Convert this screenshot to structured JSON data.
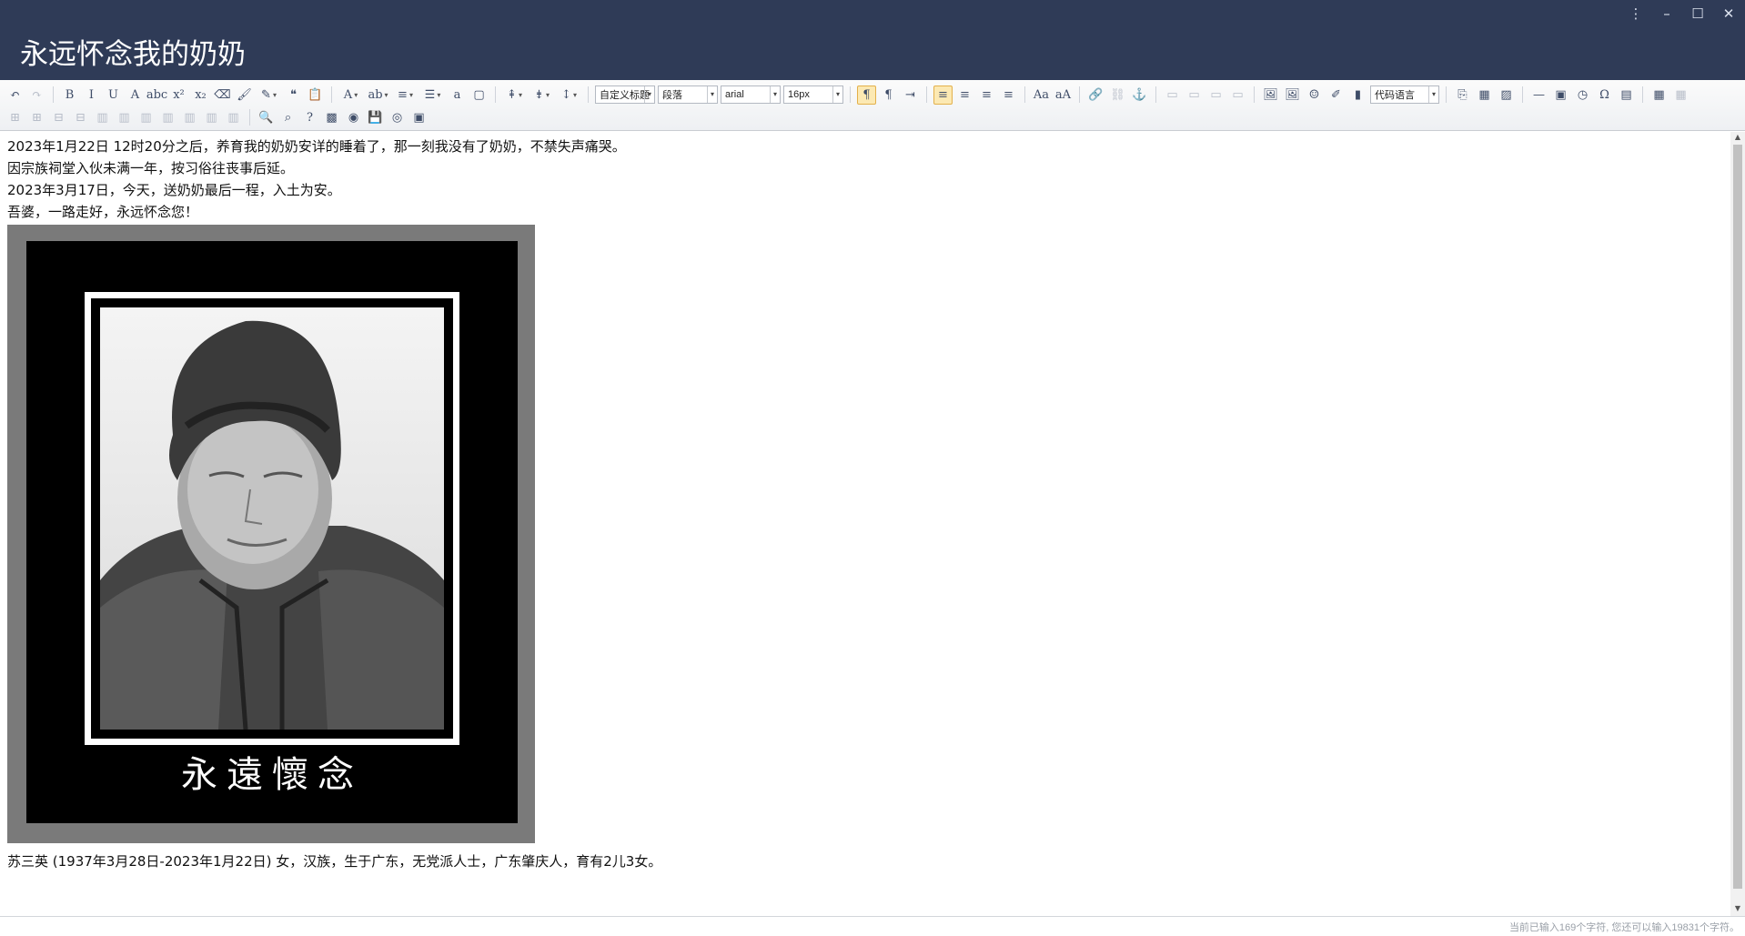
{
  "window": {
    "title": "永远怀念我的奶奶",
    "controls": [
      "⋮",
      "–",
      "☐",
      "✕"
    ]
  },
  "toolbar": {
    "row1_groups": [
      [
        {
          "name": "undo-icon",
          "glyph": "↶"
        },
        {
          "name": "redo-icon",
          "glyph": "↷",
          "dim": true
        }
      ],
      [
        {
          "name": "bold-icon",
          "glyph": "B"
        },
        {
          "name": "italic-icon",
          "glyph": "I"
        },
        {
          "name": "underline-icon",
          "glyph": "U"
        },
        {
          "name": "font-border-icon",
          "glyph": "A"
        },
        {
          "name": "strikethrough-icon",
          "glyph": "abc"
        },
        {
          "name": "superscript-icon",
          "glyph": "x²"
        },
        {
          "name": "subscript-icon",
          "glyph": "x₂"
        },
        {
          "name": "remove-format-icon",
          "glyph": "⌫"
        },
        {
          "name": "format-brush-icon",
          "glyph": "🖌"
        },
        {
          "name": "auto-typeset-icon",
          "glyph": "✎",
          "arrow": true
        },
        {
          "name": "blockquote-icon",
          "glyph": "❝"
        },
        {
          "name": "paste-plain-icon",
          "glyph": "📋"
        }
      ],
      [
        {
          "name": "font-color-icon",
          "glyph": "A",
          "arrow": true
        },
        {
          "name": "highlight-color-icon",
          "glyph": "ab",
          "arrow": true
        },
        {
          "name": "ordered-list-icon",
          "glyph": "≡",
          "arrow": true
        },
        {
          "name": "unordered-list-icon",
          "glyph": "☰",
          "arrow": true
        },
        {
          "name": "select-all-icon",
          "glyph": "a"
        },
        {
          "name": "clear-doc-icon",
          "glyph": "▢"
        }
      ],
      [
        {
          "name": "row-spacing-top-icon",
          "glyph": "⇞",
          "arrow": true
        },
        {
          "name": "row-spacing-bottom-icon",
          "glyph": "⇟",
          "arrow": true
        },
        {
          "name": "line-height-icon",
          "glyph": "↕",
          "arrow": true
        }
      ]
    ],
    "custom_style_select": "自定义标题",
    "paragraph_select": "段落",
    "font_family_select": "arial",
    "font_size_select": "16px",
    "row1_tail": [
      [
        {
          "name": "ltr-icon",
          "glyph": "¶",
          "active": true
        },
        {
          "name": "rtl-icon",
          "glyph": "¶"
        },
        {
          "name": "indent-icon",
          "glyph": "⇥"
        }
      ],
      [
        {
          "name": "align-left-icon",
          "glyph": "≡",
          "active": true
        },
        {
          "name": "align-center-icon",
          "glyph": "≡"
        },
        {
          "name": "align-right-icon",
          "glyph": "≡"
        },
        {
          "name": "align-justify-icon",
          "glyph": "≡"
        }
      ],
      [
        {
          "name": "uppercase-icon",
          "glyph": "Aa"
        },
        {
          "name": "lowercase-icon",
          "glyph": "aA"
        }
      ],
      [
        {
          "name": "link-icon",
          "glyph": "🔗"
        },
        {
          "name": "unlink-icon",
          "glyph": "⛓",
          "dim": true
        },
        {
          "name": "anchor-icon",
          "glyph": "⚓"
        }
      ],
      [
        {
          "name": "image-none-icon",
          "glyph": "▭",
          "dim": true
        },
        {
          "name": "image-left-icon",
          "glyph": "▭",
          "dim": true
        },
        {
          "name": "image-right-icon",
          "glyph": "▭",
          "dim": true
        },
        {
          "name": "image-center-icon",
          "glyph": "▭",
          "dim": true
        }
      ],
      [
        {
          "name": "simple-upload-icon",
          "glyph": "🖼"
        },
        {
          "name": "insert-image-icon",
          "glyph": "🖼"
        },
        {
          "name": "emotion-icon",
          "glyph": "☺"
        },
        {
          "name": "scrawl-icon",
          "glyph": "✐"
        },
        {
          "name": "insert-video-icon",
          "glyph": "▮"
        }
      ],
      [
        {
          "name": "page-break-icon",
          "glyph": "⎘"
        },
        {
          "name": "template-icon",
          "glyph": "▦"
        },
        {
          "name": "background-icon",
          "glyph": "▨"
        }
      ],
      [
        {
          "name": "horizontal-rule-icon",
          "glyph": "—"
        },
        {
          "name": "date-icon",
          "glyph": "▣"
        },
        {
          "name": "time-icon",
          "glyph": "◷"
        },
        {
          "name": "special-chars-icon",
          "glyph": "Ω"
        },
        {
          "name": "wordimage-icon",
          "glyph": "▤"
        }
      ],
      [
        {
          "name": "insert-table-icon",
          "glyph": "▦"
        },
        {
          "name": "delete-table-icon",
          "glyph": "▦",
          "dim": true
        }
      ]
    ],
    "code_language_select": "代码语言",
    "row2_groups": [
      [
        {
          "name": "insert-row-icon",
          "glyph": "⊞",
          "dim": true
        },
        {
          "name": "insert-col-icon",
          "glyph": "⊞",
          "dim": true
        },
        {
          "name": "delete-row-icon",
          "glyph": "⊟",
          "dim": true
        },
        {
          "name": "delete-col-icon",
          "glyph": "⊟",
          "dim": true
        },
        {
          "name": "merge-cells-icon",
          "glyph": "▥",
          "dim": true
        },
        {
          "name": "merge-right-icon",
          "glyph": "▥",
          "dim": true
        },
        {
          "name": "merge-down-icon",
          "glyph": "▥",
          "dim": true
        },
        {
          "name": "split-cells-icon",
          "glyph": "▥",
          "dim": true
        },
        {
          "name": "split-rows-icon",
          "glyph": "▥",
          "dim": true
        },
        {
          "name": "split-cols-icon",
          "glyph": "▥",
          "dim": true
        },
        {
          "name": "chart-icon",
          "glyph": "▥",
          "dim": true
        }
      ],
      [
        {
          "name": "preview-icon",
          "glyph": "🔍"
        },
        {
          "name": "search-replace-icon",
          "glyph": "⌕"
        },
        {
          "name": "help-icon",
          "glyph": "?"
        },
        {
          "name": "image-manage-icon",
          "glyph": "▩"
        },
        {
          "name": "autosave-icon",
          "glyph": "◉"
        },
        {
          "name": "save-icon",
          "glyph": "💾"
        },
        {
          "name": "spellcheck-icon",
          "glyph": "◎"
        },
        {
          "name": "fullscreen-icon",
          "glyph": "▣"
        }
      ]
    ]
  },
  "editor": {
    "paragraphs": [
      "2023年1月22日 12时20分之后，养育我的奶奶安详的睡着了，那一刻我没有了奶奶，不禁失声痛哭。",
      "因宗族祠堂入伙未满一年，按习俗往丧事后延。",
      "2023年3月17日，今天，送奶奶最后一程，入土为安。",
      "吾婆，一路走好，永远怀念您！"
    ],
    "memorial_caption": "永遠懷念",
    "footer_paragraph": "苏三英 (1937年3月28日-2023年1月22日) 女，汉族，生于广东，无党派人士，广东肇庆人，育有2儿3女。"
  },
  "status": {
    "word_count": "当前已输入169个字符, 您还可以输入19831个字符。"
  }
}
